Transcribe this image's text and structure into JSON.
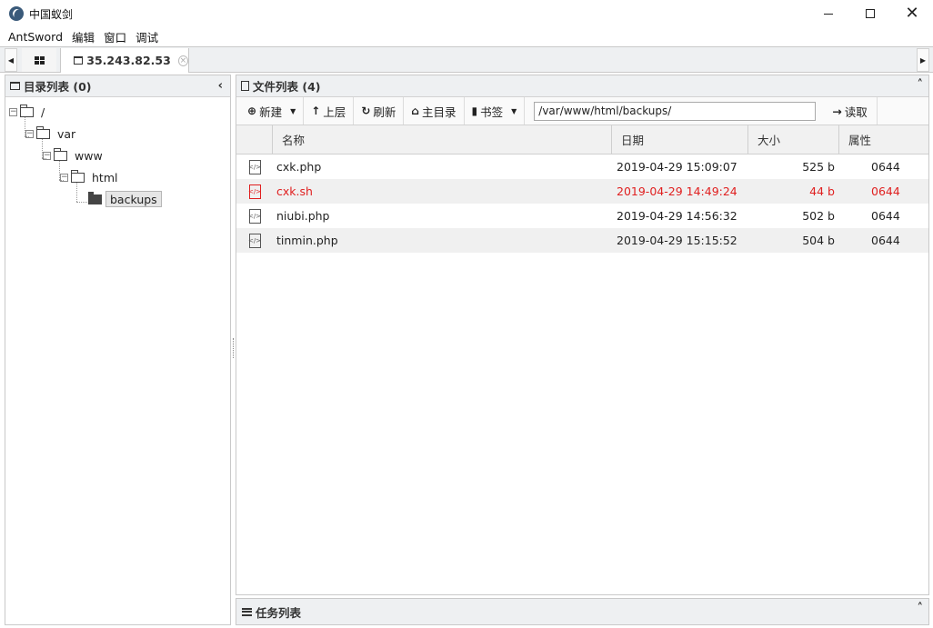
{
  "window": {
    "title": "中国蚁剑",
    "controls": {
      "minimize": "—",
      "maximize": "☐",
      "close": "✕"
    }
  },
  "menu": [
    "AntSword",
    "编辑",
    "窗口",
    "调试"
  ],
  "tabs": {
    "active_tab_label": "35.243.82.53",
    "close_glyph": "×",
    "scroll_left": "◀",
    "scroll_right": "▶"
  },
  "dir_panel": {
    "title": "目录列表 (0)",
    "collapse": "‹",
    "tree": [
      {
        "label": "/",
        "level": 0
      },
      {
        "label": "var",
        "level": 1
      },
      {
        "label": "www",
        "level": 2
      },
      {
        "label": "html",
        "level": 3
      },
      {
        "label": "backups",
        "level": 4,
        "selected": true
      }
    ]
  },
  "file_panel": {
    "title": "文件列表 (4)",
    "collapse": "˄",
    "toolbar": {
      "new": "新建",
      "up": "上层",
      "refresh": "刷新",
      "home": "主目录",
      "bookmarks": "书签",
      "path_value": "/var/www/html/backups/",
      "read": "读取"
    },
    "columns": [
      "名称",
      "日期",
      "大小",
      "属性"
    ],
    "rows": [
      {
        "name": "cxk.php",
        "date": "2019-04-29 15:09:07",
        "size": "525 b",
        "perm": "0644",
        "highlight": false
      },
      {
        "name": "cxk.sh",
        "date": "2019-04-29 14:49:24",
        "size": "44 b",
        "perm": "0644",
        "highlight": true
      },
      {
        "name": "niubi.php",
        "date": "2019-04-29 14:56:32",
        "size": "502 b",
        "perm": "0644",
        "highlight": false
      },
      {
        "name": "tinmin.php",
        "date": "2019-04-29 15:15:52",
        "size": "504 b",
        "perm": "0644",
        "highlight": false
      }
    ]
  },
  "task_panel": {
    "title": "任务列表",
    "collapse": "˄"
  },
  "colors": {
    "highlight_row_text": "#e02020",
    "panel_header_bg": "#eef0f2"
  }
}
